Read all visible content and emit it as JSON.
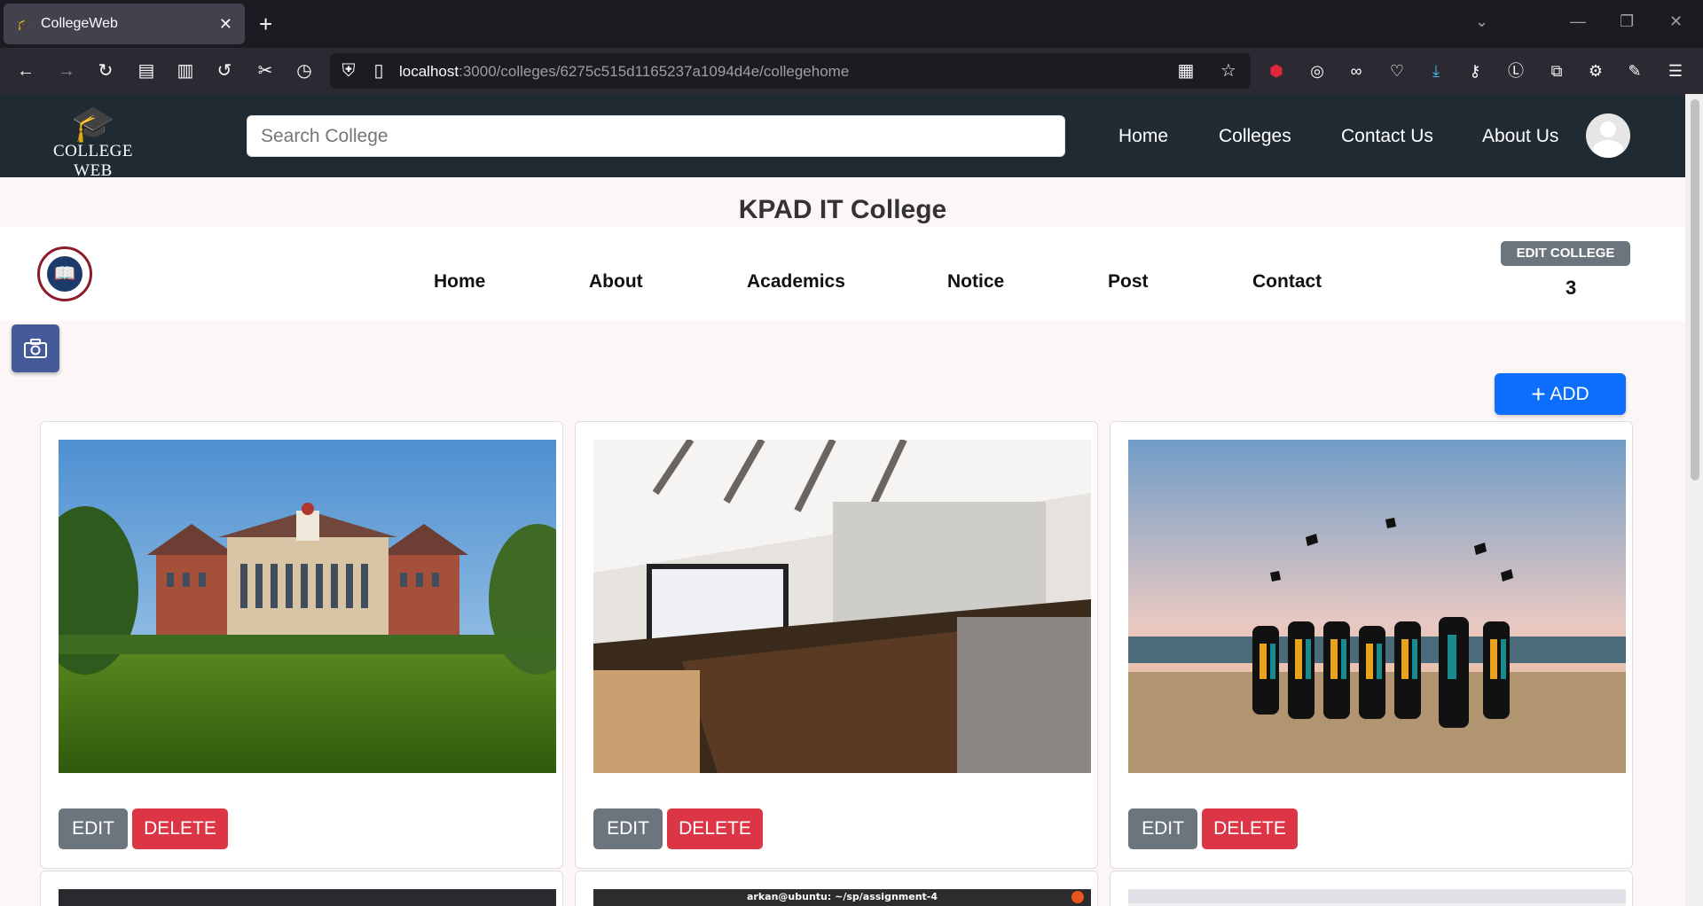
{
  "browser": {
    "tab_title": "CollegeWeb",
    "tab_close": "✕",
    "new_tab": "+",
    "url_host": "localhost",
    "url_path": ":3000/colleges/6275c515d1165237a1094d4e/collegehome"
  },
  "header": {
    "logo_text": "COLLEGE WEB",
    "search_placeholder": "Search College",
    "nav": [
      "Home",
      "Colleges",
      "Contact Us",
      "About Us"
    ]
  },
  "college": {
    "name": "KPAD IT College",
    "nav": [
      "Home",
      "About",
      "Academics",
      "Notice",
      "Post",
      "Contact"
    ],
    "edit_label": "EDIT COLLEGE",
    "count": "3"
  },
  "actions": {
    "add_label": "ADD",
    "add_icon": "+"
  },
  "cards": [
    {
      "image": "university-building-photo",
      "edit_label": "EDIT",
      "delete_label": "DELETE"
    },
    {
      "image": "lecture-hall-photo",
      "edit_label": "EDIT",
      "delete_label": "DELETE"
    },
    {
      "image": "graduation-caps-photo",
      "edit_label": "EDIT",
      "delete_label": "DELETE"
    }
  ],
  "partial_cards": [
    {
      "image": "dark-screenshot"
    },
    {
      "image": "terminal-screenshot",
      "title": "arkan@ubuntu: ~/sp/assignment-4"
    },
    {
      "image": "browser-screenshot"
    }
  ]
}
